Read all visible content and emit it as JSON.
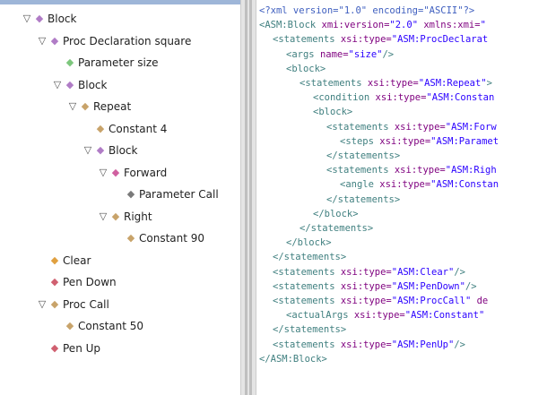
{
  "tree": {
    "nodes": [
      {
        "label": "Block",
        "depth": 0,
        "expanded": true,
        "icon_color": "#b07cc6"
      },
      {
        "label": "Proc Declaration square",
        "depth": 1,
        "expanded": true,
        "icon_color": "#b07cc6"
      },
      {
        "label": "Parameter size",
        "depth": 2,
        "expanded": null,
        "icon_color": "#7dc77d"
      },
      {
        "label": "Block",
        "depth": 2,
        "expanded": true,
        "icon_color": "#b07cc6"
      },
      {
        "label": "Repeat",
        "depth": 3,
        "expanded": true,
        "icon_color": "#c8a36a"
      },
      {
        "label": "Constant 4",
        "depth": 4,
        "expanded": null,
        "icon_color": "#c8a36a"
      },
      {
        "label": "Block",
        "depth": 4,
        "expanded": true,
        "icon_color": "#b07cc6"
      },
      {
        "label": "Forward",
        "depth": 5,
        "expanded": true,
        "icon_color": "#d060a0"
      },
      {
        "label": "Parameter Call",
        "depth": 6,
        "expanded": null,
        "icon_color": "#7a7a7a"
      },
      {
        "label": "Right",
        "depth": 5,
        "expanded": true,
        "icon_color": "#c8a36a"
      },
      {
        "label": "Constant 90",
        "depth": 6,
        "expanded": null,
        "icon_color": "#c8a36a"
      },
      {
        "label": "Clear",
        "depth": 1,
        "expanded": null,
        "icon_color": "#e0a040"
      },
      {
        "label": "Pen Down",
        "depth": 1,
        "expanded": null,
        "icon_color": "#d06070"
      },
      {
        "label": "Proc Call",
        "depth": 1,
        "expanded": true,
        "icon_color": "#c8a36a"
      },
      {
        "label": "Constant 50",
        "depth": 2,
        "expanded": null,
        "icon_color": "#c8a36a"
      },
      {
        "label": "Pen Up",
        "depth": 1,
        "expanded": null,
        "icon_color": "#d06070"
      }
    ]
  },
  "xml": {
    "lines": [
      {
        "indent": 0,
        "parts": [
          [
            "pi",
            "<?xml version=\"1.0\" encoding=\"ASCII\"?>"
          ]
        ]
      },
      {
        "indent": 0,
        "parts": [
          [
            "tag",
            "<ASM:Block "
          ],
          [
            "attr",
            "xmi:version="
          ],
          [
            "val",
            "\"2.0\""
          ],
          [
            "attr",
            " xmlns:xmi="
          ],
          [
            "val",
            "\""
          ]
        ]
      },
      {
        "indent": 1,
        "parts": [
          [
            "tag",
            "<statements "
          ],
          [
            "attr",
            "xsi:type="
          ],
          [
            "val",
            "\"ASM:ProcDeclarat"
          ]
        ]
      },
      {
        "indent": 2,
        "parts": [
          [
            "tag",
            "<args "
          ],
          [
            "attr",
            "name="
          ],
          [
            "val",
            "\"size\""
          ],
          [
            "tag",
            "/>"
          ]
        ]
      },
      {
        "indent": 2,
        "parts": [
          [
            "tag",
            "<block>"
          ]
        ]
      },
      {
        "indent": 3,
        "parts": [
          [
            "tag",
            "<statements "
          ],
          [
            "attr",
            "xsi:type="
          ],
          [
            "val",
            "\"ASM:Repeat\""
          ],
          [
            "tag",
            ">"
          ]
        ]
      },
      {
        "indent": 4,
        "parts": [
          [
            "tag",
            "<condition "
          ],
          [
            "attr",
            "xsi:type="
          ],
          [
            "val",
            "\"ASM:Constan"
          ]
        ]
      },
      {
        "indent": 4,
        "parts": [
          [
            "tag",
            "<block>"
          ]
        ]
      },
      {
        "indent": 5,
        "parts": [
          [
            "tag",
            "<statements "
          ],
          [
            "attr",
            "xsi:type="
          ],
          [
            "val",
            "\"ASM:Forw"
          ]
        ]
      },
      {
        "indent": 6,
        "parts": [
          [
            "tag",
            "<steps "
          ],
          [
            "attr",
            "xsi:type="
          ],
          [
            "val",
            "\"ASM:Paramet"
          ]
        ]
      },
      {
        "indent": 5,
        "parts": [
          [
            "tag",
            "</statements>"
          ]
        ]
      },
      {
        "indent": 5,
        "parts": [
          [
            "tag",
            "<statements "
          ],
          [
            "attr",
            "xsi:type="
          ],
          [
            "val",
            "\"ASM:Righ"
          ]
        ]
      },
      {
        "indent": 6,
        "parts": [
          [
            "tag",
            "<angle "
          ],
          [
            "attr",
            "xsi:type="
          ],
          [
            "val",
            "\"ASM:Constan"
          ]
        ]
      },
      {
        "indent": 5,
        "parts": [
          [
            "tag",
            "</statements>"
          ]
        ]
      },
      {
        "indent": 4,
        "parts": [
          [
            "tag",
            "</block>"
          ]
        ]
      },
      {
        "indent": 3,
        "parts": [
          [
            "tag",
            "</statements>"
          ]
        ]
      },
      {
        "indent": 2,
        "parts": [
          [
            "tag",
            "</block>"
          ]
        ]
      },
      {
        "indent": 1,
        "parts": [
          [
            "tag",
            "</statements>"
          ]
        ]
      },
      {
        "indent": 1,
        "parts": [
          [
            "tag",
            "<statements "
          ],
          [
            "attr",
            "xsi:type="
          ],
          [
            "val",
            "\"ASM:Clear\""
          ],
          [
            "tag",
            "/>"
          ]
        ]
      },
      {
        "indent": 1,
        "parts": [
          [
            "tag",
            "<statements "
          ],
          [
            "attr",
            "xsi:type="
          ],
          [
            "val",
            "\"ASM:PenDown\""
          ],
          [
            "tag",
            "/>"
          ]
        ]
      },
      {
        "indent": 1,
        "parts": [
          [
            "tag",
            "<statements "
          ],
          [
            "attr",
            "xsi:type="
          ],
          [
            "val",
            "\"ASM:ProcCall\""
          ],
          [
            "attr",
            " de"
          ]
        ]
      },
      {
        "indent": 2,
        "parts": [
          [
            "tag",
            "<actualArgs "
          ],
          [
            "attr",
            "xsi:type="
          ],
          [
            "val",
            "\"ASM:Constant\""
          ]
        ]
      },
      {
        "indent": 1,
        "parts": [
          [
            "tag",
            "</statements>"
          ]
        ]
      },
      {
        "indent": 1,
        "parts": [
          [
            "tag",
            "<statements "
          ],
          [
            "attr",
            "xsi:type="
          ],
          [
            "val",
            "\"ASM:PenUp\""
          ],
          [
            "tag",
            "/>"
          ]
        ]
      },
      {
        "indent": 0,
        "parts": [
          [
            "tag",
            "</ASM:Block>"
          ]
        ]
      }
    ]
  },
  "icons": {
    "expanded_toggle": "▽",
    "node_diamond": "◆"
  }
}
